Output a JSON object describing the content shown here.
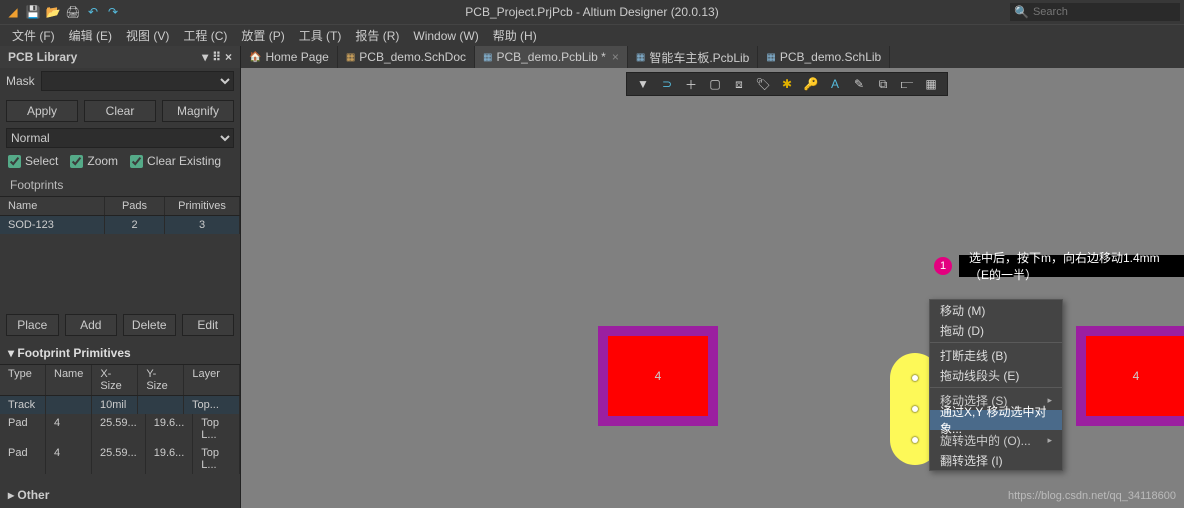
{
  "title": "PCB_Project.PrjPcb - Altium Designer (20.0.13)",
  "search_placeholder": "Search",
  "menus": [
    "文件 (F)",
    "编辑 (E)",
    "视图 (V)",
    "工程 (C)",
    "放置 (P)",
    "工具 (T)",
    "报告 (R)",
    "Window (W)",
    "帮助 (H)"
  ],
  "panel": {
    "title": "PCB Library",
    "mask_label": "Mask",
    "apply": "Apply",
    "clear": "Clear",
    "magnify": "Magnify",
    "mode": "Normal",
    "chk_select": "Select",
    "chk_zoom": "Zoom",
    "chk_clear": "Clear Existing",
    "footprints_label": "Footprints",
    "fp_headers": {
      "name": "Name",
      "pads": "Pads",
      "prims": "Primitives"
    },
    "fp_row": {
      "name": "SOD-123",
      "pads": "2",
      "prims": "3"
    },
    "place": "Place",
    "add": "Add",
    "delete": "Delete",
    "edit": "Edit",
    "primitives_title": "Footprint Primitives",
    "pr_headers": {
      "type": "Type",
      "name": "Name",
      "xsize": "X-Size",
      "ysize": "Y-Size",
      "layer": "Layer"
    },
    "pr_rows": [
      {
        "type": "Track",
        "name": "",
        "xsize": "10mil",
        "ysize": "",
        "layer": "Top..."
      },
      {
        "type": "Pad",
        "name": "4",
        "xsize": "25.59...",
        "ysize": "19.6...",
        "layer": "Top L..."
      },
      {
        "type": "Pad",
        "name": "4",
        "xsize": "25.59...",
        "ysize": "19.6...",
        "layer": "Top L..."
      }
    ],
    "other": "Other"
  },
  "tabs": [
    {
      "icon": "🏠",
      "label": "Home Page"
    },
    {
      "icon": "📄",
      "label": "PCB_demo.SchDoc"
    },
    {
      "icon": "📄",
      "label": "PCB_demo.PcbLib *",
      "active": true,
      "close": true
    },
    {
      "icon": "📄",
      "label": "智能车主板.PcbLib"
    },
    {
      "icon": "📄",
      "label": "PCB_demo.SchLib"
    }
  ],
  "pad_label": "4",
  "annotation": {
    "badge": "1",
    "text": "选中后，按下m，向右边移动1.4mm（E的一半）"
  },
  "context_menu": [
    {
      "label": "移动 (M)"
    },
    {
      "label": "拖动 (D)"
    },
    {
      "sep": true
    },
    {
      "label": "打断走线 (B)"
    },
    {
      "label": "拖动线段头 (E)"
    },
    {
      "sep": true
    },
    {
      "label": "移动选择 (S)",
      "arrow": true
    },
    {
      "label": "通过X,Y 移动选中对象...",
      "sel": true
    },
    {
      "label": "旋转选中的 (O)...",
      "arrow": true
    },
    {
      "label": "翻转选择 (I)"
    }
  ],
  "watermark": "https://blog.csdn.net/qq_34118600"
}
